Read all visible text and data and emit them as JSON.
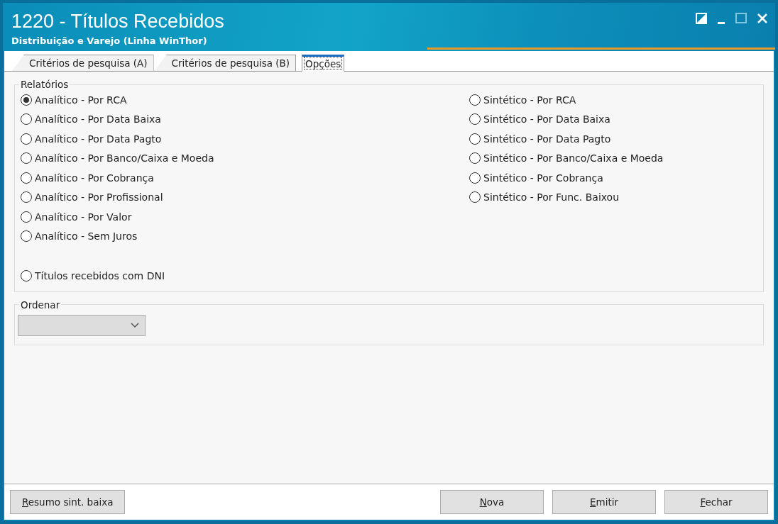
{
  "window": {
    "title": "1220 - Títulos Recebidos",
    "subtitle": "Distribuição e Varejo (Linha WinThor)"
  },
  "tabs": [
    {
      "label": "Critérios de pesquisa (A)",
      "selected": false
    },
    {
      "label": "Critérios de pesquisa (B)",
      "selected": false
    },
    {
      "label": "Opções",
      "selected": true
    }
  ],
  "relatorios": {
    "legend": "Relatórios",
    "left_column": [
      {
        "label": "Analítico - Por RCA",
        "selected": true
      },
      {
        "label": "Analítico - Por Data Baixa",
        "selected": false
      },
      {
        "label": "Analítico - Por Data Pagto",
        "selected": false
      },
      {
        "label": "Analítico - Por Banco/Caixa e Moeda",
        "selected": false
      },
      {
        "label": "Analítico - Por Cobrança",
        "selected": false
      },
      {
        "label": "Analítico - Por Profissional",
        "selected": false
      },
      {
        "label": "Analítico - Por Valor",
        "selected": false
      },
      {
        "label": "Analítico - Sem Juros",
        "selected": false
      }
    ],
    "right_column": [
      {
        "label": "Sintético - Por RCA",
        "selected": false
      },
      {
        "label": "Sintético - Por Data Baixa",
        "selected": false
      },
      {
        "label": "Sintético - Por Data Pagto",
        "selected": false
      },
      {
        "label": "Sintético - Por Banco/Caixa e Moeda",
        "selected": false
      },
      {
        "label": "Sintético - Por Cobrança",
        "selected": false
      },
      {
        "label": "Sintético - Por Func. Baixou",
        "selected": false
      }
    ],
    "extra": [
      {
        "label": "Títulos recebidos com DNI",
        "selected": false
      }
    ]
  },
  "ordenar": {
    "legend": "Ordenar",
    "disabled": true
  },
  "buttons_left": [
    "Resumo sint. baixa"
  ],
  "buttons_right": [
    "Nova",
    "Emitir",
    "Fechar"
  ]
}
